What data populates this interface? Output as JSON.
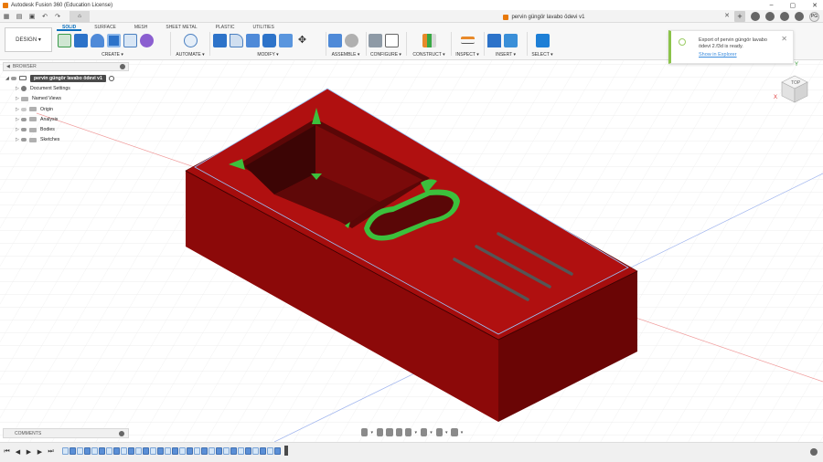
{
  "app": {
    "window_title": "Autodesk Fusion 360 (Education License)",
    "logo_icon": "fusion-logo-icon"
  },
  "tabbar": {
    "document_title": "pervin güngör lavabo ödevi v1",
    "close_label": "✕",
    "new_tab_label": "+",
    "user_initials": "PG"
  },
  "ribbon": {
    "workspace": "DESIGN ▾",
    "tabs": [
      "SOLID",
      "SURFACE",
      "MESH",
      "SHEET METAL",
      "PLASTIC",
      "UTILITIES"
    ],
    "active_tab": "SOLID",
    "groups": [
      {
        "label": "CREATE ▾"
      },
      {
        "label": "AUTOMATE ▾"
      },
      {
        "label": "MODIFY ▾"
      },
      {
        "label": "ASSEMBLE ▾"
      },
      {
        "label": "CONFIGURE ▾"
      },
      {
        "label": "CONSTRUCT ▾"
      },
      {
        "label": "INSPECT ▾"
      },
      {
        "label": "INSERT ▾"
      },
      {
        "label": "SELECT ▾"
      }
    ]
  },
  "notification": {
    "message": "Export of pervin güngör lavabo ödevi 2.f3d is ready.",
    "link": "Show in Explorer",
    "close": "✕"
  },
  "browser": {
    "header": "BROWSER",
    "root": "pervin güngör lavabo ödevi v1",
    "children": [
      "Document Settings",
      "Named Views",
      "Origin",
      "Analysis",
      "Bodies",
      "Sketches"
    ]
  },
  "comments": {
    "label": "COMMENTS"
  },
  "viewcube": {
    "top_label": "TOP",
    "axis_x": "X",
    "axis_y": "Y"
  },
  "colors": {
    "body_red": "#a00c0c",
    "body_dark": "#6e0606",
    "highlight_green": "#3cc03c",
    "accent_blue": "#0a6ebd"
  }
}
